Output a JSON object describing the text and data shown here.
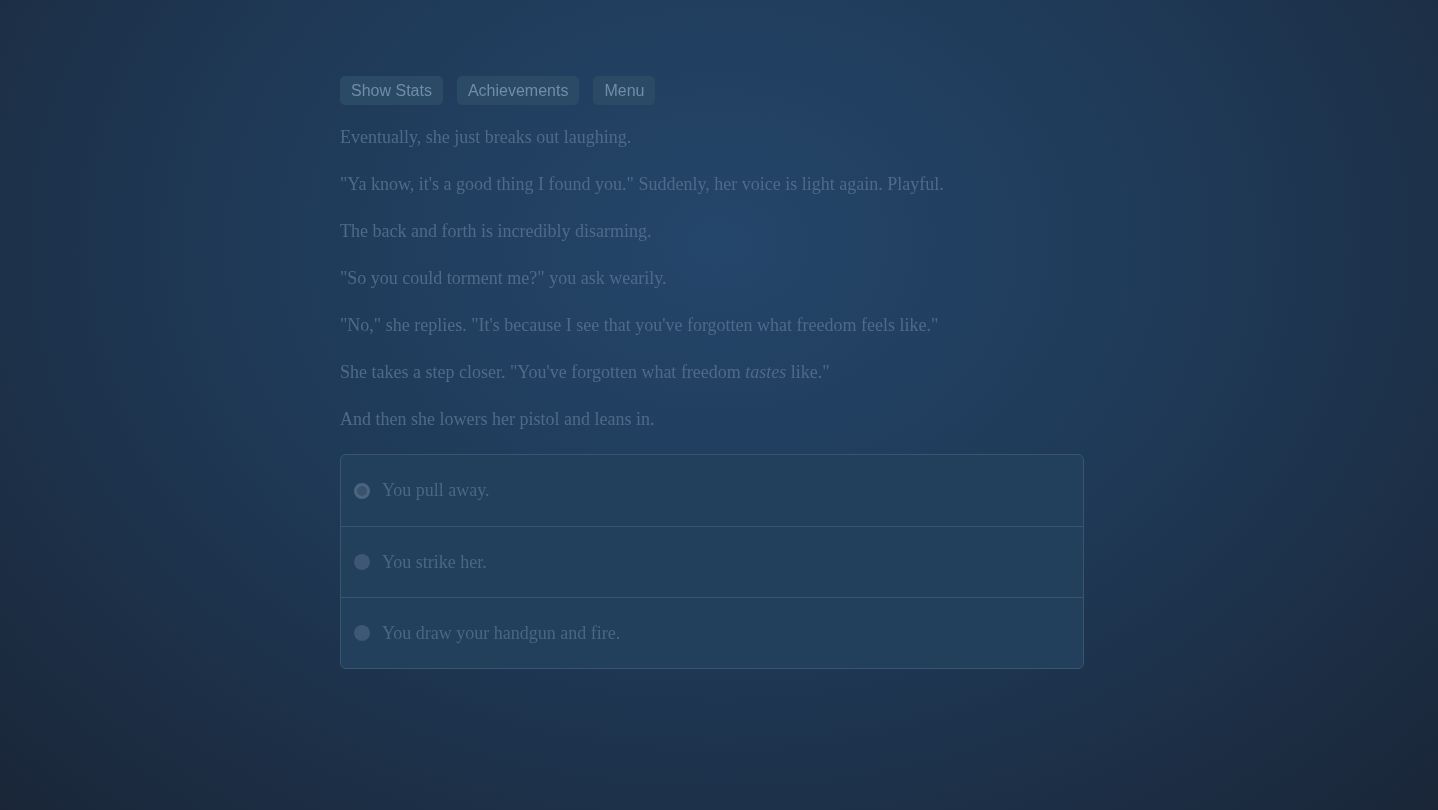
{
  "toolbar": [
    {
      "label": "Show Stats"
    },
    {
      "label": "Achievements"
    },
    {
      "label": "Menu"
    }
  ],
  "paragraphs": [
    "Eventually, she just breaks out laughing.",
    "\"Ya know, it's a good thing I found you.\" Suddenly, her voice is light again. Playful.",
    "The back and forth is incredibly disarming.",
    "\"So you could torment me?\" you ask wearily.",
    "\"No,\" she replies. \"It's because I see that you've forgotten what freedom feels like.\"",
    "She takes a step closer. \"You've forgotten what freedom *tastes* like.\"",
    "And then she lowers her pistol and leans in."
  ],
  "choices": [
    {
      "label": "You pull away.",
      "selected": true
    },
    {
      "label": "You strike her.",
      "selected": false
    },
    {
      "label": "You draw your handgun and fire.",
      "selected": false
    }
  ]
}
